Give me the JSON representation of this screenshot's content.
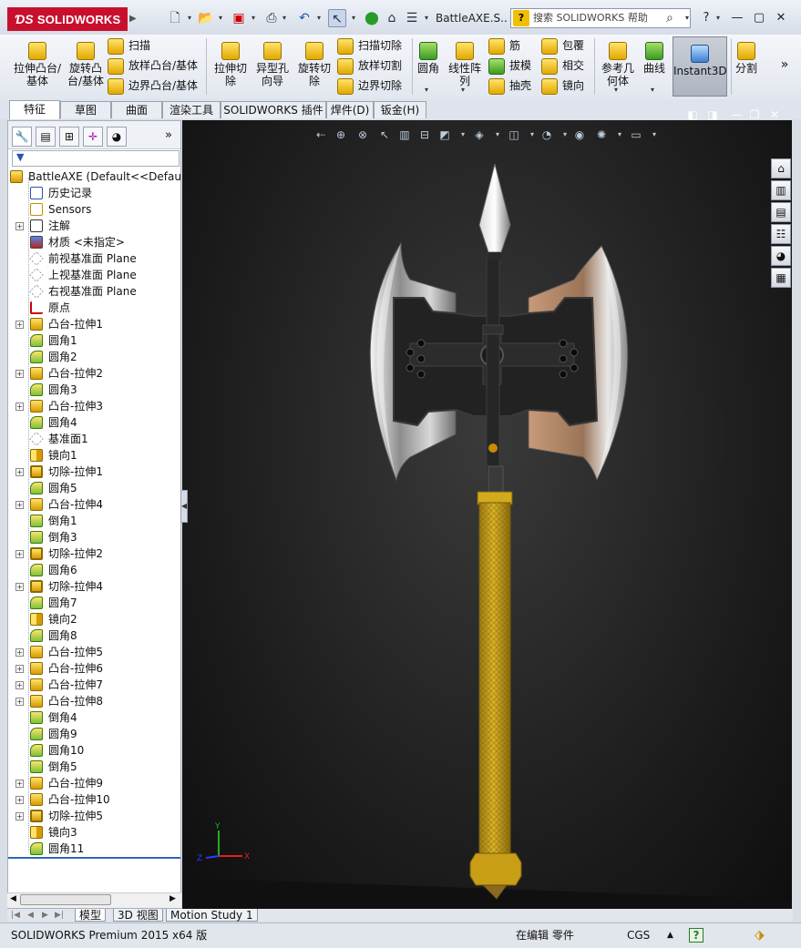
{
  "app": {
    "logo_text": "SOLIDWORKS",
    "document_title": "BattleAXE.S...",
    "help_search_placeholder": "搜索 SOLIDWORKS 帮助"
  },
  "ribbon": {
    "extrude_boss": "拉伸凸台/基体",
    "revolve_boss": "旋转凸台/基体",
    "sweep": "扫描",
    "loft": "放样凸台/基体",
    "boundary": "边界凸台/基体",
    "extrude_cut": "拉伸切除",
    "hole_wizard": "异型孔向导",
    "revolve_cut": "旋转切除",
    "sweep_cut": "扫描切除",
    "loft_cut": "放样切割",
    "boundary_cut": "边界切除",
    "fillet": "圆角",
    "linear_pattern": "线性阵列",
    "rib": "筋",
    "draft": "拔模",
    "shell": "抽壳",
    "wrap": "包覆",
    "intersect": "相交",
    "mirror": "镜向",
    "ref_geometry": "参考几何体",
    "curves": "曲线",
    "instant3d": "Instant3D",
    "split": "分割",
    "more": "»"
  },
  "tabs": [
    "特征",
    "草图",
    "曲面",
    "渲染工具",
    "SOLIDWORKS 插件",
    "焊件(D)",
    "钣金(H)"
  ],
  "tree": {
    "root": "BattleAXE  (Default<<Default",
    "items": [
      {
        "label": "历史记录",
        "icon": "history-icon",
        "plus": false
      },
      {
        "label": "Sensors",
        "icon": "sensor-icon",
        "plus": false
      },
      {
        "label": "注解",
        "icon": "annotation-icon",
        "plus": true
      },
      {
        "label": "材质 <未指定>",
        "icon": "material-icon",
        "plus": false
      },
      {
        "label": "前视基准面 Plane",
        "icon": "plane-icon",
        "plus": false
      },
      {
        "label": "上视基准面 Plane",
        "icon": "plane-icon",
        "plus": false
      },
      {
        "label": "右视基准面 Plane",
        "icon": "plane-icon",
        "plus": false
      },
      {
        "label": "原点",
        "icon": "origin-icon",
        "plus": false
      },
      {
        "label": "凸台-拉伸1",
        "icon": "extrude-icon",
        "plus": true
      },
      {
        "label": "圆角1",
        "icon": "fillet-icon",
        "plus": false
      },
      {
        "label": "圆角2",
        "icon": "fillet-icon",
        "plus": false
      },
      {
        "label": "凸台-拉伸2",
        "icon": "extrude-icon",
        "plus": true
      },
      {
        "label": "圆角3",
        "icon": "fillet-icon",
        "plus": false
      },
      {
        "label": "凸台-拉伸3",
        "icon": "extrude-icon",
        "plus": true
      },
      {
        "label": "圆角4",
        "icon": "fillet-icon",
        "plus": false
      },
      {
        "label": "基准面1",
        "icon": "plane-icon",
        "plus": false
      },
      {
        "label": "镜向1",
        "icon": "mirror-icon",
        "plus": false
      },
      {
        "label": "切除-拉伸1",
        "icon": "cut-icon",
        "plus": true
      },
      {
        "label": "圆角5",
        "icon": "fillet-icon",
        "plus": false
      },
      {
        "label": "凸台-拉伸4",
        "icon": "extrude-icon",
        "plus": true
      },
      {
        "label": "倒角1",
        "icon": "chamfer-icon",
        "plus": false
      },
      {
        "label": "倒角3",
        "icon": "chamfer-icon",
        "plus": false
      },
      {
        "label": "切除-拉伸2",
        "icon": "cut-icon",
        "plus": true
      },
      {
        "label": "圆角6",
        "icon": "fillet-icon",
        "plus": false
      },
      {
        "label": "切除-拉伸4",
        "icon": "cut-icon",
        "plus": true
      },
      {
        "label": "圆角7",
        "icon": "fillet-icon",
        "plus": false
      },
      {
        "label": "镜向2",
        "icon": "mirror-icon",
        "plus": false
      },
      {
        "label": "圆角8",
        "icon": "fillet-icon",
        "plus": false
      },
      {
        "label": "凸台-拉伸5",
        "icon": "extrude-icon",
        "plus": true
      },
      {
        "label": "凸台-拉伸6",
        "icon": "extrude-icon",
        "plus": true
      },
      {
        "label": "凸台-拉伸7",
        "icon": "extrude-icon",
        "plus": true
      },
      {
        "label": "凸台-拉伸8",
        "icon": "extrude-icon",
        "plus": true
      },
      {
        "label": "倒角4",
        "icon": "chamfer-icon",
        "plus": false
      },
      {
        "label": "圆角9",
        "icon": "fillet-icon",
        "plus": false
      },
      {
        "label": "圆角10",
        "icon": "fillet-icon",
        "plus": false
      },
      {
        "label": "倒角5",
        "icon": "chamfer-icon",
        "plus": false
      },
      {
        "label": "凸台-拉伸9",
        "icon": "extrude-icon",
        "plus": true
      },
      {
        "label": "凸台-拉伸10",
        "icon": "extrude-icon",
        "plus": true
      },
      {
        "label": "切除-拉伸5",
        "icon": "cut-icon",
        "plus": true
      },
      {
        "label": "镜向3",
        "icon": "mirror-icon",
        "plus": false
      },
      {
        "label": "圆角11",
        "icon": "fillet-icon",
        "plus": false
      }
    ]
  },
  "bottom_tabs": [
    "模型",
    "3D 视图",
    "Motion Study 1"
  ],
  "status": {
    "product": "SOLIDWORKS Premium 2015 x64 版",
    "mode": "在编辑 零件",
    "units": "CGS",
    "units_arrow": "▲",
    "help": "?"
  },
  "colors": {
    "brand_red": "#c8102e",
    "selection_blue": "#2f67b5",
    "viewport_bg": "#1c1c1c",
    "handle_gold": "#d4a818"
  }
}
